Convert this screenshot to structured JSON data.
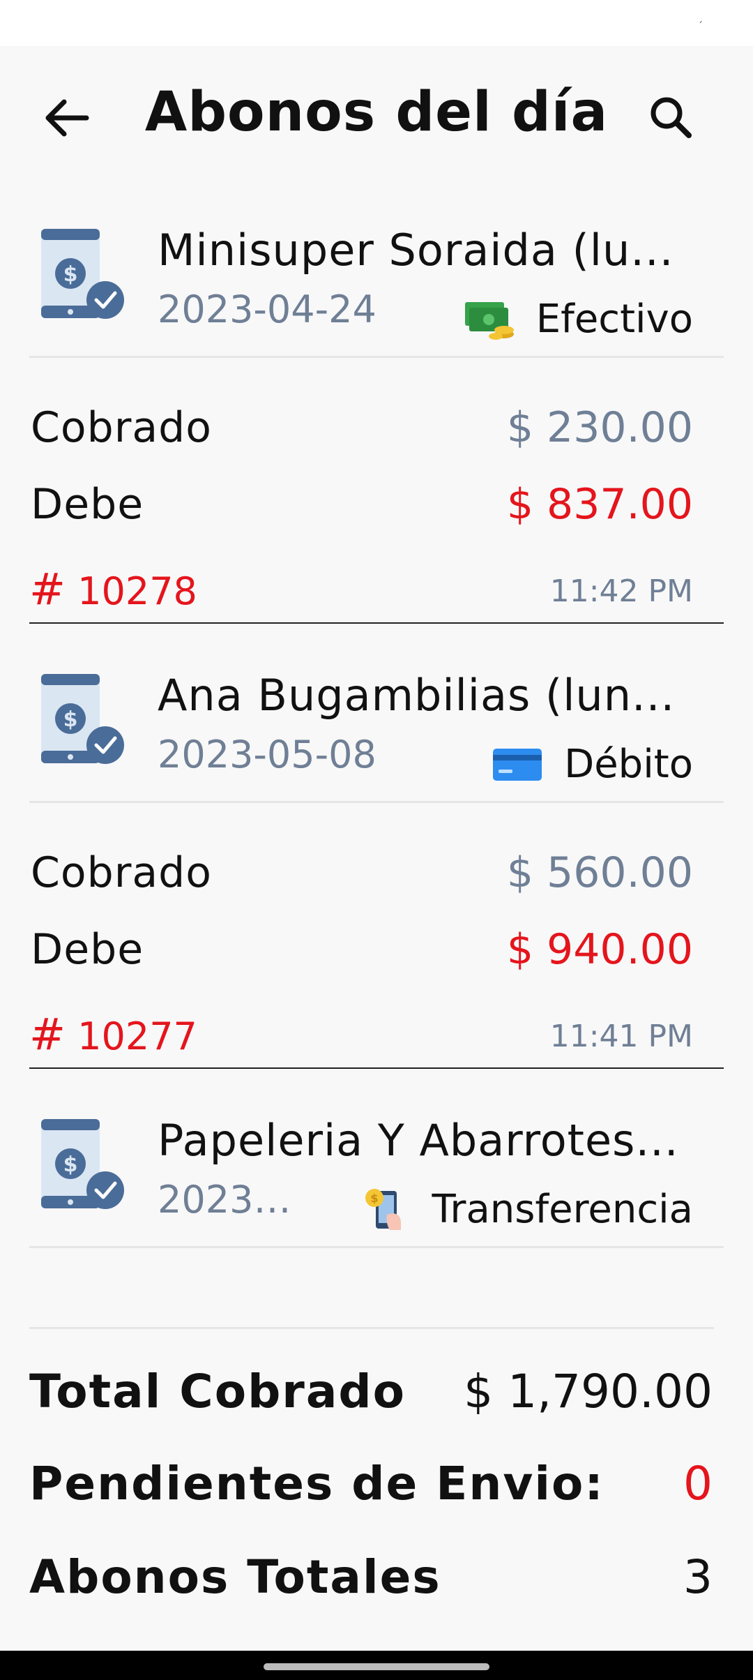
{
  "app_bar": {
    "title": "Abonos del día"
  },
  "cards": [
    {
      "client": "Minisuper Soraida (lu...",
      "date": "2023-04-24",
      "method": "Efectivo",
      "method_icon": "cash-icon",
      "cobrado_label": "Cobrado",
      "cobrado": "$ 230.00",
      "debe_label": "Debe",
      "debe": "$ 837.00",
      "hash": "#",
      "folio": "10278",
      "time": "11:42 PM"
    },
    {
      "client": "Ana Bugambilias (lun...",
      "date": "2023-05-08",
      "method": "Débito",
      "method_icon": "credit-card-icon",
      "cobrado_label": "Cobrado",
      "cobrado": "$ 560.00",
      "debe_label": "Debe",
      "debe": "$ 940.00",
      "hash": "#",
      "folio": "10277",
      "time": "11:41 PM"
    },
    {
      "client": "Papeleria Y Abarrotes...",
      "date": "2023-...",
      "method": "Transferencia",
      "method_icon": "phone-coin-icon"
    }
  ],
  "totals": {
    "cobrado_label": "Total Cobrado",
    "cobrado_value": "$ 1,790.00",
    "pendientes_label": "Pendientes de Envio:",
    "pendientes_value": "0",
    "abonos_label": "Abonos Totales",
    "abonos_value": "3"
  },
  "colors": {
    "accent_red": "#e4151c",
    "muted_blue_grey": "#6f7f95",
    "icon_blue": "#4a6c98"
  }
}
